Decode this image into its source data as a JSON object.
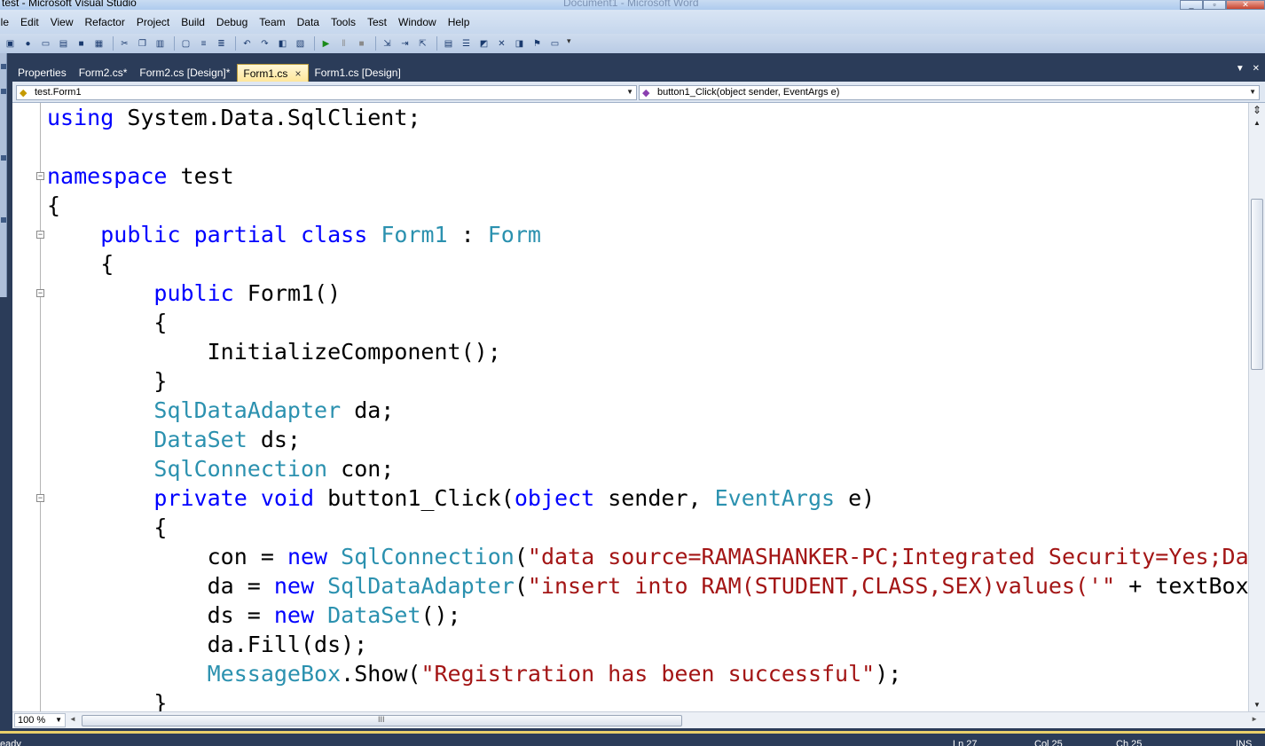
{
  "window": {
    "title": "test - Microsoft Visual Studio",
    "ghost_title": "Document1 - Microsoft Word"
  },
  "menu": {
    "items": [
      "ile",
      "Edit",
      "View",
      "Refactor",
      "Project",
      "Build",
      "Debug",
      "Team",
      "Data",
      "Tools",
      "Test",
      "Window",
      "Help"
    ]
  },
  "toolbar": {
    "icons": [
      "new-project-icon",
      "add-item-icon",
      "open-icon",
      "add-existing-icon",
      "save-icon",
      "save-all-icon",
      "cut-icon",
      "copy-icon",
      "paste-icon",
      "find-icon",
      "comment-icon",
      "uncomment-icon",
      "undo-icon",
      "redo-icon",
      "navigate-icon",
      "find-in-files-icon",
      "start-debug-icon",
      "pause-icon",
      "stop-icon",
      "step-into-icon",
      "step-over-icon",
      "step-out-icon",
      "solution-explorer-icon",
      "properties-icon",
      "object-browser-icon",
      "toolbox-icon",
      "class-view-icon",
      "error-list-icon",
      "start-page-icon"
    ]
  },
  "tabs": [
    {
      "label": "Properties",
      "active": false
    },
    {
      "label": "Form2.cs*",
      "active": false
    },
    {
      "label": "Form2.cs [Design]*",
      "active": false
    },
    {
      "label": "Form1.cs",
      "active": true
    },
    {
      "label": "Form1.cs [Design]",
      "active": false
    }
  ],
  "tab_close_glyph": "×",
  "nav": {
    "type_selector": "test.Form1",
    "member_selector": "button1_Click(object sender, EventArgs e)"
  },
  "code": {
    "lines": [
      [
        [
          "kw",
          "using"
        ],
        [
          "",
          ""
        ],
        [
          "",
          " System.Data.SqlClient;"
        ]
      ],
      [
        [
          "",
          ""
        ]
      ],
      [
        [
          "kw",
          "namespace"
        ],
        [
          "",
          " test"
        ]
      ],
      [
        [
          "",
          "{"
        ]
      ],
      [
        [
          "",
          "    "
        ],
        [
          "kw",
          "public partial class"
        ],
        [
          "",
          " "
        ],
        [
          "ty",
          "Form1"
        ],
        [
          "",
          " : "
        ],
        [
          "ty",
          "Form"
        ]
      ],
      [
        [
          "",
          "    {"
        ]
      ],
      [
        [
          "",
          "        "
        ],
        [
          "kw",
          "public"
        ],
        [
          "",
          " Form1()"
        ]
      ],
      [
        [
          "",
          "        {"
        ]
      ],
      [
        [
          "",
          "            InitializeComponent();"
        ]
      ],
      [
        [
          "",
          "        }"
        ]
      ],
      [
        [
          "",
          "        "
        ],
        [
          "ty",
          "SqlDataAdapter"
        ],
        [
          "",
          " da;"
        ]
      ],
      [
        [
          "",
          "        "
        ],
        [
          "ty",
          "DataSet"
        ],
        [
          "",
          " ds;"
        ]
      ],
      [
        [
          "",
          "        "
        ],
        [
          "ty",
          "SqlConnection"
        ],
        [
          "",
          " con;"
        ]
      ],
      [
        [
          "",
          "        "
        ],
        [
          "kw",
          "private void"
        ],
        [
          "",
          " button1_Click("
        ],
        [
          "kw",
          "object"
        ],
        [
          "",
          " sender, "
        ],
        [
          "ty",
          "EventArgs"
        ],
        [
          "",
          " e)"
        ]
      ],
      [
        [
          "",
          "        {"
        ]
      ],
      [
        [
          "",
          "            con = "
        ],
        [
          "kw",
          "new"
        ],
        [
          "",
          " "
        ],
        [
          "ty",
          "SqlConnection"
        ],
        [
          "",
          "("
        ],
        [
          "st",
          "\"data source=RAMASHANKER-PC;Integrated Security=Yes;Da"
        ]
      ],
      [
        [
          "",
          "            da = "
        ],
        [
          "kw",
          "new"
        ],
        [
          "",
          " "
        ],
        [
          "ty",
          "SqlDataAdapter"
        ],
        [
          "",
          "("
        ],
        [
          "st",
          "\"insert into RAM(STUDENT,CLASS,SEX)values('\""
        ],
        [
          "",
          " + textBox"
        ]
      ],
      [
        [
          "",
          "            ds = "
        ],
        [
          "kw",
          "new"
        ],
        [
          "",
          " "
        ],
        [
          "ty",
          "DataSet"
        ],
        [
          "",
          "();"
        ]
      ],
      [
        [
          "",
          "            da.Fill(ds);"
        ]
      ],
      [
        [
          "",
          "            "
        ],
        [
          "ty",
          "MessageBox"
        ],
        [
          "",
          ".Show("
        ],
        [
          "st",
          "\"Registration has been successful\""
        ],
        [
          "",
          ");"
        ]
      ],
      [
        [
          "",
          "        }"
        ]
      ]
    ]
  },
  "zoom": "100 %",
  "status": {
    "left": "eady",
    "ln": "Ln 27",
    "col": "Col 25",
    "ch": "Ch 25",
    "mode": "INS"
  }
}
